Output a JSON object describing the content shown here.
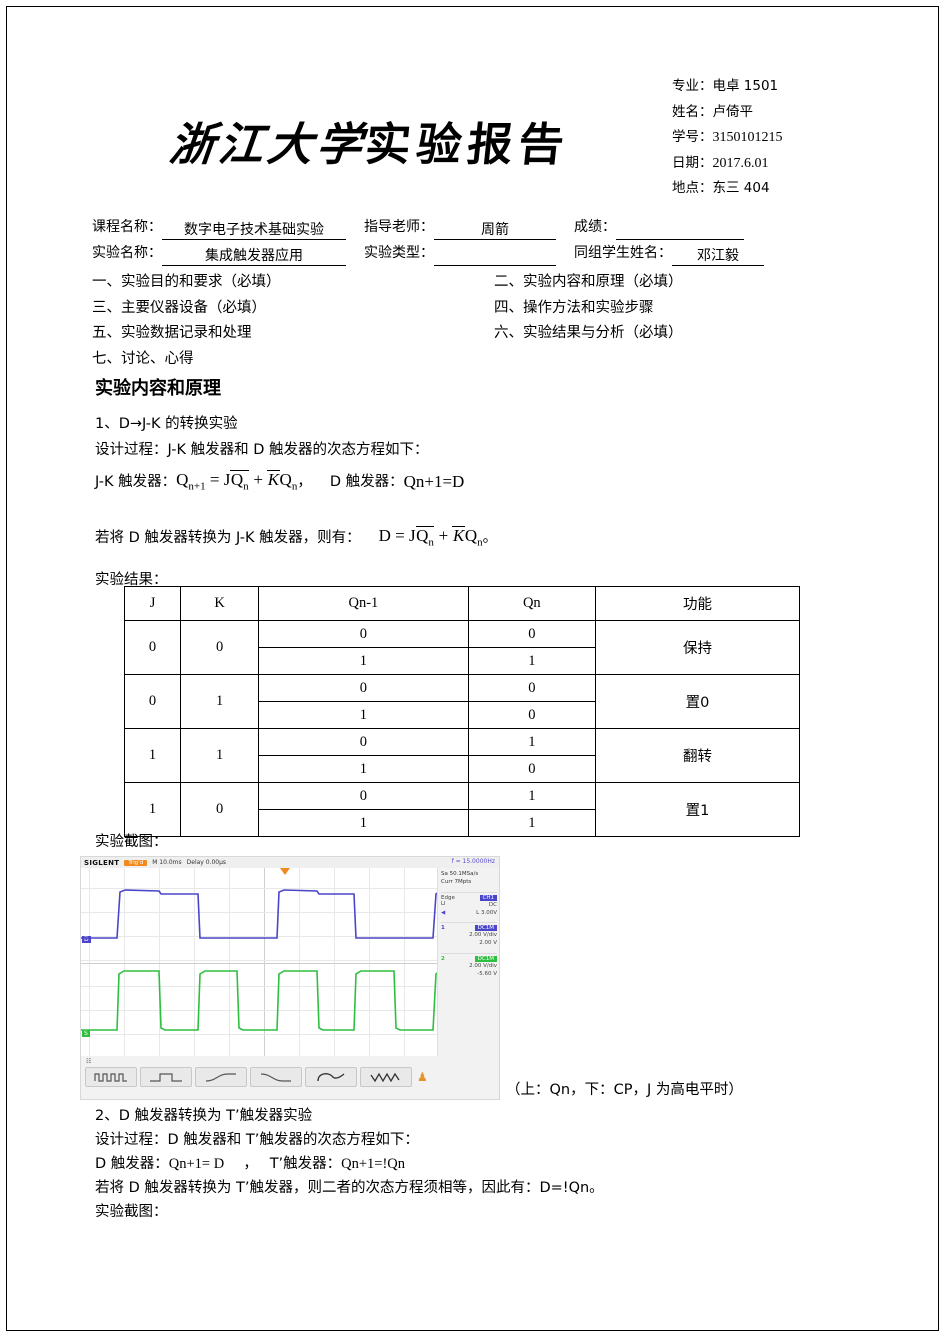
{
  "header": {
    "university_title_cursive": "浙江大学",
    "university_title_block": "实验报告",
    "meta": [
      {
        "label": "专业：",
        "value": "电卓 1501"
      },
      {
        "label": "姓名：",
        "value": "卢倚平"
      },
      {
        "label": "学号：",
        "value": "3150101215"
      },
      {
        "label": "日期：",
        "value": "2017.6.01"
      },
      {
        "label": "地点：",
        "value": "东三 404"
      }
    ]
  },
  "fields": {
    "course_label": "课程名称：",
    "course_value": "数字电子技术基础实验",
    "teacher_label": "指导老师：",
    "teacher_value": "周箭",
    "score_label": "成绩：",
    "score_value": "",
    "exp_name_label": "实验名称：",
    "exp_name_value": "集成触发器应用",
    "exp_type_label": "实验类型：",
    "exp_type_value": "",
    "partner_label": "同组学生姓名：",
    "partner_value": "邓江毅"
  },
  "sections": [
    {
      "left": "一、实验目的和要求（必填）",
      "right": "二、实验内容和原理（必填）"
    },
    {
      "left": "三、主要仪器设备（必填）",
      "right": "四、操作方法和实验步骤"
    },
    {
      "left": "五、实验数据记录和处理",
      "right": "六、实验结果与分析（必填）"
    },
    {
      "left": "七、讨论、心得",
      "right": ""
    }
  ],
  "body": {
    "title": "实验内容和原理",
    "item1_heading": "1、D→J-K 的转换实验",
    "item1_design": "设计过程：J-K 触发器和 D 触发器的次态方程如下：",
    "jk_label": "J-K 触发器：",
    "d_label": "D 触发器：",
    "d_equation": "Qn+1=D",
    "convert_text": "若将 D 触发器转换为 J-K 触发器，则有：",
    "result_label": "实验结果：",
    "screenshot_label": "实验截图：",
    "caption": "（上：Qn，下：CP，J 为高电平时）",
    "item2_heading": "2、D 触发器转换为 T’触发器实验",
    "item2_design": "设计过程：D 触发器和 T’触发器的次态方程如下：",
    "item2_d_label": "D 触发器：",
    "item2_d_eq": "Qn+1= D",
    "item2_t_label": "T’触发器：",
    "item2_t_eq": "Qn+1=!Qn",
    "item2_convert": "若将 D 触发器转换为 T’触发器，则二者的次态方程须相等，因此有：D=!Qn。",
    "item2_screenshot_label": "实验截图：",
    "formula_parts": {
      "q_next": "Q",
      "sub_n1": "n+1",
      "eq": "=",
      "j": "J",
      "qbar": "Q",
      "sub_n": "n",
      "plus": "+",
      "kbar": "K",
      "comma": "，",
      "d": "D",
      "period": "。"
    }
  },
  "truth_table": {
    "headers": [
      "J",
      "K",
      "Qn-1",
      "Qn",
      "功能"
    ],
    "groups": [
      {
        "j": "0",
        "k": "0",
        "pairs": [
          [
            "0",
            "0"
          ],
          [
            "1",
            "1"
          ]
        ],
        "fn": "保持"
      },
      {
        "j": "0",
        "k": "1",
        "pairs": [
          [
            "0",
            "0"
          ],
          [
            "1",
            "0"
          ]
        ],
        "fn": "置0"
      },
      {
        "j": "1",
        "k": "1",
        "pairs": [
          [
            "0",
            "1"
          ],
          [
            "1",
            "0"
          ]
        ],
        "fn": "翻转"
      },
      {
        "j": "1",
        "k": "0",
        "pairs": [
          [
            "0",
            "1"
          ],
          [
            "1",
            "1"
          ]
        ],
        "fn": "置1"
      }
    ]
  },
  "scope": {
    "brand": "SIGLENT",
    "trig_status": "Trig'd",
    "timebase": "M 10.0ms",
    "delay": "Delay 0.00µs",
    "frequency": "f = 15.0000Hz",
    "sample_rate": "Sa 50.1MSa/s",
    "memory": "Curr 7Mpts",
    "trigger_type": "Edge",
    "trigger_source": "CH1",
    "trigger_coupling": "DC",
    "trigger_level": "L 3.00V",
    "channels": [
      {
        "num": "1",
        "coupling": "DC1M",
        "scale": "2.00 V/div",
        "offset": "2.00 V",
        "color": "#4b45c9"
      },
      {
        "num": "2",
        "coupling": "DC1M",
        "scale": "2.00 V/div",
        "offset": "-5.60 V",
        "color": "#2fbf3f"
      }
    ],
    "marker_ch1": "D",
    "marker_ch2": "S",
    "wave_buttons": [
      "square-pulse-train",
      "single-pulse",
      "rising-edge",
      "falling-edge",
      "overshoot",
      "ringing"
    ]
  }
}
